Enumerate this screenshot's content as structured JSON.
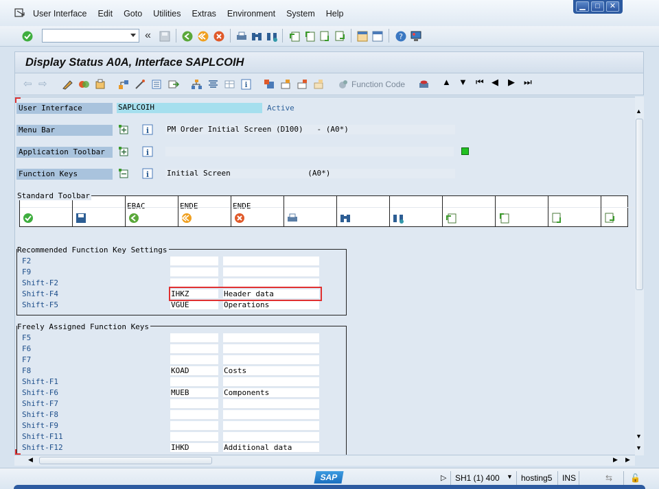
{
  "menu": {
    "items": [
      "User Interface",
      "Edit",
      "Goto",
      "Utilities",
      "Extras",
      "Environment",
      "System",
      "Help"
    ]
  },
  "window_controls": {
    "minimize": "▁",
    "maximize": "□",
    "close": "✕"
  },
  "title": "Display Status A0A, Interface SAPLCOIH",
  "app_toolbar": {
    "function_code_label": "Function Code"
  },
  "fields": {
    "user_interface": {
      "label": "User Interface",
      "value": "SAPLCOIH",
      "status": "Active"
    },
    "menu_bar": {
      "label": "Menu Bar",
      "value": "PM Order Initial Screen (D100)   - (A0*)"
    },
    "application_toolbar": {
      "label": "Application Toolbar",
      "value": ""
    },
    "function_keys": {
      "label": "Function Keys",
      "value": "Initial Screen                 (A0*)"
    }
  },
  "standard_toolbar": {
    "title": "Standard Toolbar",
    "buttons": [
      {
        "code": "",
        "icon": "check-icon"
      },
      {
        "code": "",
        "icon": "save-icon"
      },
      {
        "code": "EBAC",
        "icon": "back-icon"
      },
      {
        "code": "ENDE",
        "icon": "exit-icon"
      },
      {
        "code": "ENDE",
        "icon": "cancel-icon"
      },
      {
        "code": "",
        "icon": "print-icon"
      },
      {
        "code": "",
        "icon": "find-icon"
      },
      {
        "code": "",
        "icon": "find-next-icon"
      },
      {
        "code": "",
        "icon": "first-page-icon"
      },
      {
        "code": "",
        "icon": "previous-page-icon"
      },
      {
        "code": "",
        "icon": "next-page-icon"
      },
      {
        "code": "",
        "icon": "last-page-icon"
      }
    ]
  },
  "recommended_keys": {
    "title": "Recommended Function Key Settings",
    "rows": [
      {
        "key": "F2",
        "code": "",
        "text": ""
      },
      {
        "key": "F9",
        "code": "",
        "text": ""
      },
      {
        "key": "Shift-F2",
        "code": "",
        "text": ""
      },
      {
        "key": "Shift-F4",
        "code": "IHKZ",
        "text": "Header data"
      },
      {
        "key": "Shift-F5",
        "code": "VGUE",
        "text": "Operations"
      }
    ]
  },
  "freely_assigned_keys": {
    "title": "Freely Assigned Function Keys",
    "rows": [
      {
        "key": "F5",
        "code": "",
        "text": ""
      },
      {
        "key": "F6",
        "code": "",
        "text": ""
      },
      {
        "key": "F7",
        "code": "",
        "text": ""
      },
      {
        "key": "F8",
        "code": "KOAD",
        "text": "Costs"
      },
      {
        "key": "Shift-F1",
        "code": "",
        "text": ""
      },
      {
        "key": "Shift-F6",
        "code": "MUEB",
        "text": "Components"
      },
      {
        "key": "Shift-F7",
        "code": "",
        "text": ""
      },
      {
        "key": "Shift-F8",
        "code": "",
        "text": ""
      },
      {
        "key": "Shift-F9",
        "code": "",
        "text": ""
      },
      {
        "key": "Shift-F11",
        "code": "",
        "text": ""
      },
      {
        "key": "Shift-F12",
        "code": "IHKD",
        "text": "Additional data"
      }
    ]
  },
  "status_bar": {
    "session": "SH1 (1) 400",
    "server": "hosting5",
    "mode": "INS",
    "logo": "SAP"
  },
  "colors": {
    "accent": "#2c5aa0",
    "label_bg": "#a9c3dd",
    "highlight": "#e03030",
    "active_text": "#2b5f99",
    "status_green": "#22c022"
  }
}
